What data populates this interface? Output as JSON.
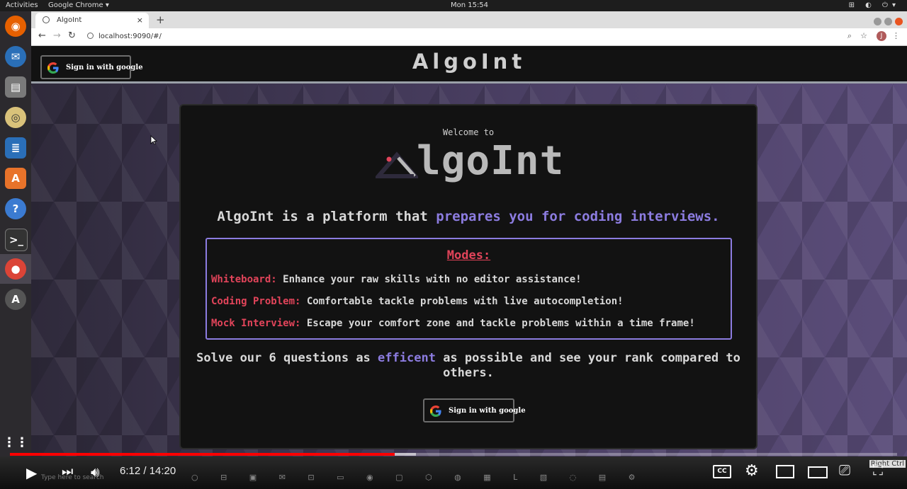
{
  "system_bar": {
    "activities": "Activities",
    "app_menu": "Google Chrome ▾",
    "clock": "Mon 15:54"
  },
  "browser": {
    "tab_title": "AlgoInt",
    "url": "localhost:9090/#/",
    "avatar_initial": "J"
  },
  "page": {
    "header_title": "AlgoInt",
    "header_signin": "Sign in with google",
    "welcome": "Welcome to",
    "logo_text": "lgoInt",
    "tagline_plain": "AlgoInt is a platform that",
    "tagline_highlight": "prepares you for coding interviews.",
    "modes": {
      "title": "Modes:",
      "items": [
        {
          "key": "Whiteboard:",
          "desc": "Enhance your raw skills with no editor assistance!"
        },
        {
          "key": "Coding Problem:",
          "desc": "Comfortable tackle problems with live autocompletion!"
        },
        {
          "key": "Mock Interview:",
          "desc": "Escape your comfort zone and tackle problems within a time frame!"
        }
      ]
    },
    "solve_pre": "Solve our 6 questions as",
    "solve_highlight": "efficent",
    "solve_post": "as possible and see your rank compared to others.",
    "card_signin": "Sign in with google"
  },
  "player": {
    "time": "6:12 / 14:20",
    "progress_fraction": 0.434,
    "buffered_fraction": 0.458
  },
  "taskbar": {
    "search_placeholder": "Type here to search",
    "right_ctrl": "Right Ctrl"
  },
  "colors": {
    "accent_purple": "#8c7ce0",
    "accent_red": "#e2445a",
    "youtube_red": "#ff0000"
  }
}
